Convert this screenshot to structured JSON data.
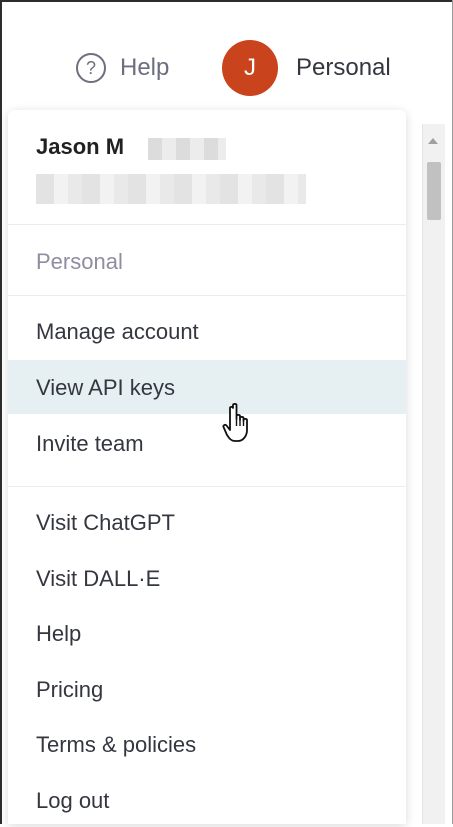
{
  "header": {
    "help_label": "Help",
    "help_icon": "?",
    "avatar_initial": "J",
    "avatar_color": "#c9431d",
    "account_label": "Personal"
  },
  "menu": {
    "user_name": "Jason M",
    "org_label": "Personal",
    "section_a": [
      {
        "label": "Manage account"
      },
      {
        "label": "View API keys"
      },
      {
        "label": "Invite team"
      }
    ],
    "section_b": [
      {
        "label": "Visit ChatGPT"
      },
      {
        "label": "Visit DALL·E"
      },
      {
        "label": "Help"
      },
      {
        "label": "Pricing"
      },
      {
        "label": "Terms & policies"
      },
      {
        "label": "Log out"
      }
    ],
    "highlight_color": "#e6f0f2"
  }
}
